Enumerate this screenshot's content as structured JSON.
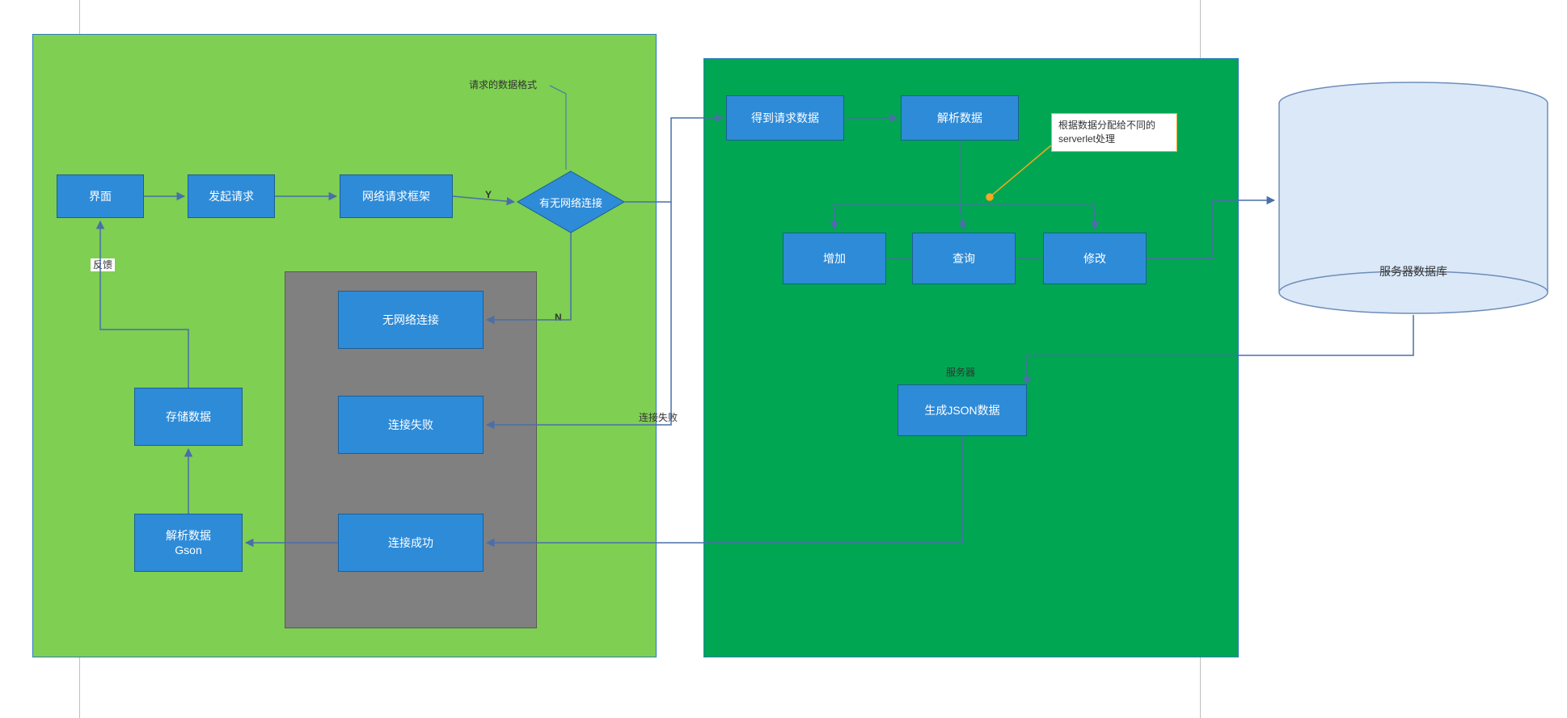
{
  "nodes": {
    "ui": "界面",
    "send_request": "发起请求",
    "net_framework": "网络请求框架",
    "has_network": "有无网络连接",
    "no_network": "无网络连接",
    "conn_fail": "连接失败",
    "conn_ok": "连接成功",
    "parse_gson": "解析数据\nGson",
    "store_data": "存储数据",
    "get_request": "得到请求数据",
    "parse_data": "解析数据",
    "add": "增加",
    "query": "查询",
    "modify": "修改",
    "gen_json": "生成JSON数据",
    "server_label": "服务器",
    "db_label": "服务器数据库"
  },
  "labels": {
    "feedback": "反馈",
    "request_format": "请求的数据格式",
    "Y": "Y",
    "N": "N",
    "conn_fail_label": "连接失败",
    "note_text": "根据数据分配给不同的serverlet处理"
  },
  "colors": {
    "blue_node": "#2e8bd8",
    "light_green": "#7ecf52",
    "dark_green": "#00a651",
    "gray": "#808080",
    "orange": "#f5a623",
    "arrow": "#4a6ea9",
    "cylinder_fill": "#dae8f8",
    "cylinder_stroke": "#6e8db9"
  }
}
